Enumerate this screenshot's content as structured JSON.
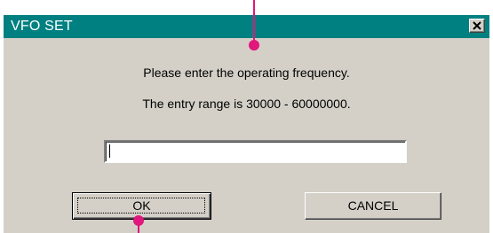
{
  "window": {
    "title": "VFO SET",
    "close_icon": "close-x-icon"
  },
  "messages": {
    "line1": "Please enter the operating frequency.",
    "line2": "The entry range is 30000 - 60000000."
  },
  "frequency_input": {
    "value": "",
    "placeholder": ""
  },
  "buttons": {
    "ok_label": "OK",
    "cancel_label": "CANCEL"
  },
  "colors": {
    "titlebar": "#008080",
    "dialog_face": "#d4d0c8",
    "callout": "#e0177c"
  }
}
